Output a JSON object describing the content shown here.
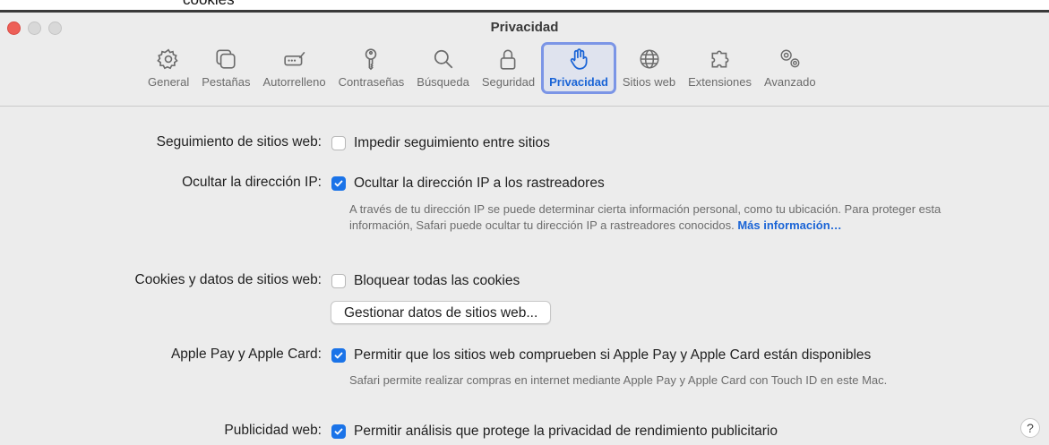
{
  "fragment_text": "cookies",
  "window": {
    "title": "Privacidad"
  },
  "toolbar": {
    "items": [
      {
        "label": "General",
        "icon": "gear-icon"
      },
      {
        "label": "Pestañas",
        "icon": "tabs-icon"
      },
      {
        "label": "Autorrelleno",
        "icon": "autofill-icon"
      },
      {
        "label": "Contraseñas",
        "icon": "key-icon"
      },
      {
        "label": "Búsqueda",
        "icon": "search-icon"
      },
      {
        "label": "Seguridad",
        "icon": "lock-icon"
      },
      {
        "label": "Privacidad",
        "icon": "hand-icon",
        "active": true
      },
      {
        "label": "Sitios web",
        "icon": "globe-icon"
      },
      {
        "label": "Extensiones",
        "icon": "puzzle-icon"
      },
      {
        "label": "Avanzado",
        "icon": "gears-icon"
      }
    ]
  },
  "settings": {
    "tracking": {
      "label": "Seguimiento de sitios web:",
      "option": "Impedir seguimiento entre sitios",
      "checked": false
    },
    "ip": {
      "label": "Ocultar la dirección IP:",
      "option": "Ocultar la dirección IP a los rastreadores",
      "checked": true,
      "desc": "A través de tu dirección IP se puede determinar cierta información personal, como tu ubicación. Para proteger esta información, Safari puede ocultar tu dirección IP a rastreadores conocidos.",
      "link": "Más información…"
    },
    "cookies": {
      "label": "Cookies y datos de sitios web:",
      "option": "Bloquear todas las cookies",
      "checked": false,
      "button": "Gestionar datos de sitios web..."
    },
    "applepay": {
      "label": "Apple Pay y Apple Card:",
      "option": "Permitir que los sitios web comprueben si Apple Pay y Apple Card están disponibles",
      "checked": true,
      "desc": "Safari permite realizar compras en internet mediante Apple Pay y Apple Card con Touch ID en este Mac."
    },
    "ads": {
      "label": "Publicidad web:",
      "option": "Permitir análisis que protege la privacidad de rendimiento publicitario",
      "checked": true
    }
  },
  "help": "?",
  "colors": {
    "accent": "#1a73e8",
    "active_border": "#7b95e6",
    "close": "#ed5f57"
  }
}
